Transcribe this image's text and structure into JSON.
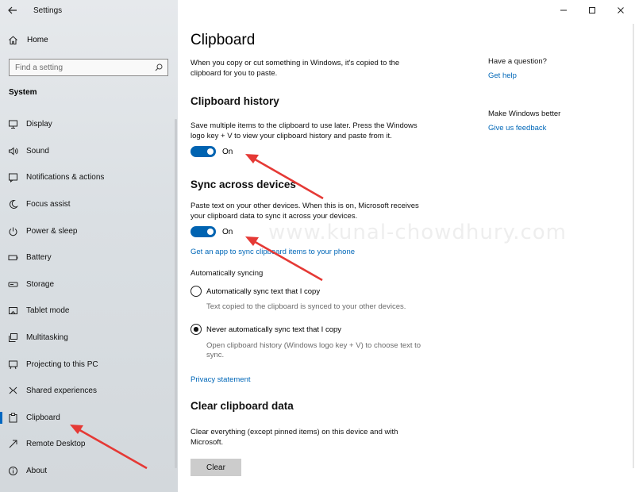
{
  "window": {
    "title": "Settings"
  },
  "sidebar": {
    "home_label": "Home",
    "search_placeholder": "Find a setting",
    "section_label": "System",
    "items": [
      {
        "label": "Display",
        "icon": "display-icon"
      },
      {
        "label": "Sound",
        "icon": "speaker-icon"
      },
      {
        "label": "Notifications & actions",
        "icon": "notifications-icon"
      },
      {
        "label": "Focus assist",
        "icon": "moon-icon"
      },
      {
        "label": "Power & sleep",
        "icon": "power-icon"
      },
      {
        "label": "Battery",
        "icon": "battery-icon"
      },
      {
        "label": "Storage",
        "icon": "storage-icon"
      },
      {
        "label": "Tablet mode",
        "icon": "tablet-icon"
      },
      {
        "label": "Multitasking",
        "icon": "multitasking-icon"
      },
      {
        "label": "Projecting to this PC",
        "icon": "projector-icon"
      },
      {
        "label": "Shared experiences",
        "icon": "shared-icon"
      },
      {
        "label": "Clipboard",
        "icon": "clipboard-icon",
        "active": true
      },
      {
        "label": "Remote Desktop",
        "icon": "remote-icon"
      },
      {
        "label": "About",
        "icon": "info-icon"
      }
    ]
  },
  "main": {
    "title": "Clipboard",
    "intro": "When you copy or cut something in Windows, it's copied to the clipboard for you to paste.",
    "history": {
      "heading": "Clipboard history",
      "description": "Save multiple items to the clipboard to use later. Press the Windows logo key + V to view your clipboard history and paste from it.",
      "toggle_state": "On"
    },
    "sync": {
      "heading": "Sync across devices",
      "description": "Paste text on your other devices. When this is on, Microsoft receives your clipboard data to sync it across your devices.",
      "toggle_state": "On",
      "app_link": "Get an app to sync clipboard items to your phone",
      "auto_label": "Automatically syncing",
      "option_auto": "Automatically sync text that I copy",
      "option_auto_hint": "Text copied to the clipboard is synced to your other devices.",
      "option_never": "Never automatically sync text that I copy",
      "option_never_hint": "Open clipboard history (Windows logo key + V) to choose text to sync."
    },
    "privacy_link": "Privacy statement",
    "clear": {
      "heading": "Clear clipboard data",
      "description": "Clear everything (except pinned items) on this device and with Microsoft.",
      "button": "Clear"
    }
  },
  "right": {
    "question": "Have a question?",
    "help_link": "Get help",
    "better": "Make Windows better",
    "feedback_link": "Give us feedback"
  },
  "watermark": "www.kunal-chowdhury.com",
  "colors": {
    "accent": "#0063b1",
    "link": "#0067b8",
    "annotation_arrow": "#e53935"
  }
}
